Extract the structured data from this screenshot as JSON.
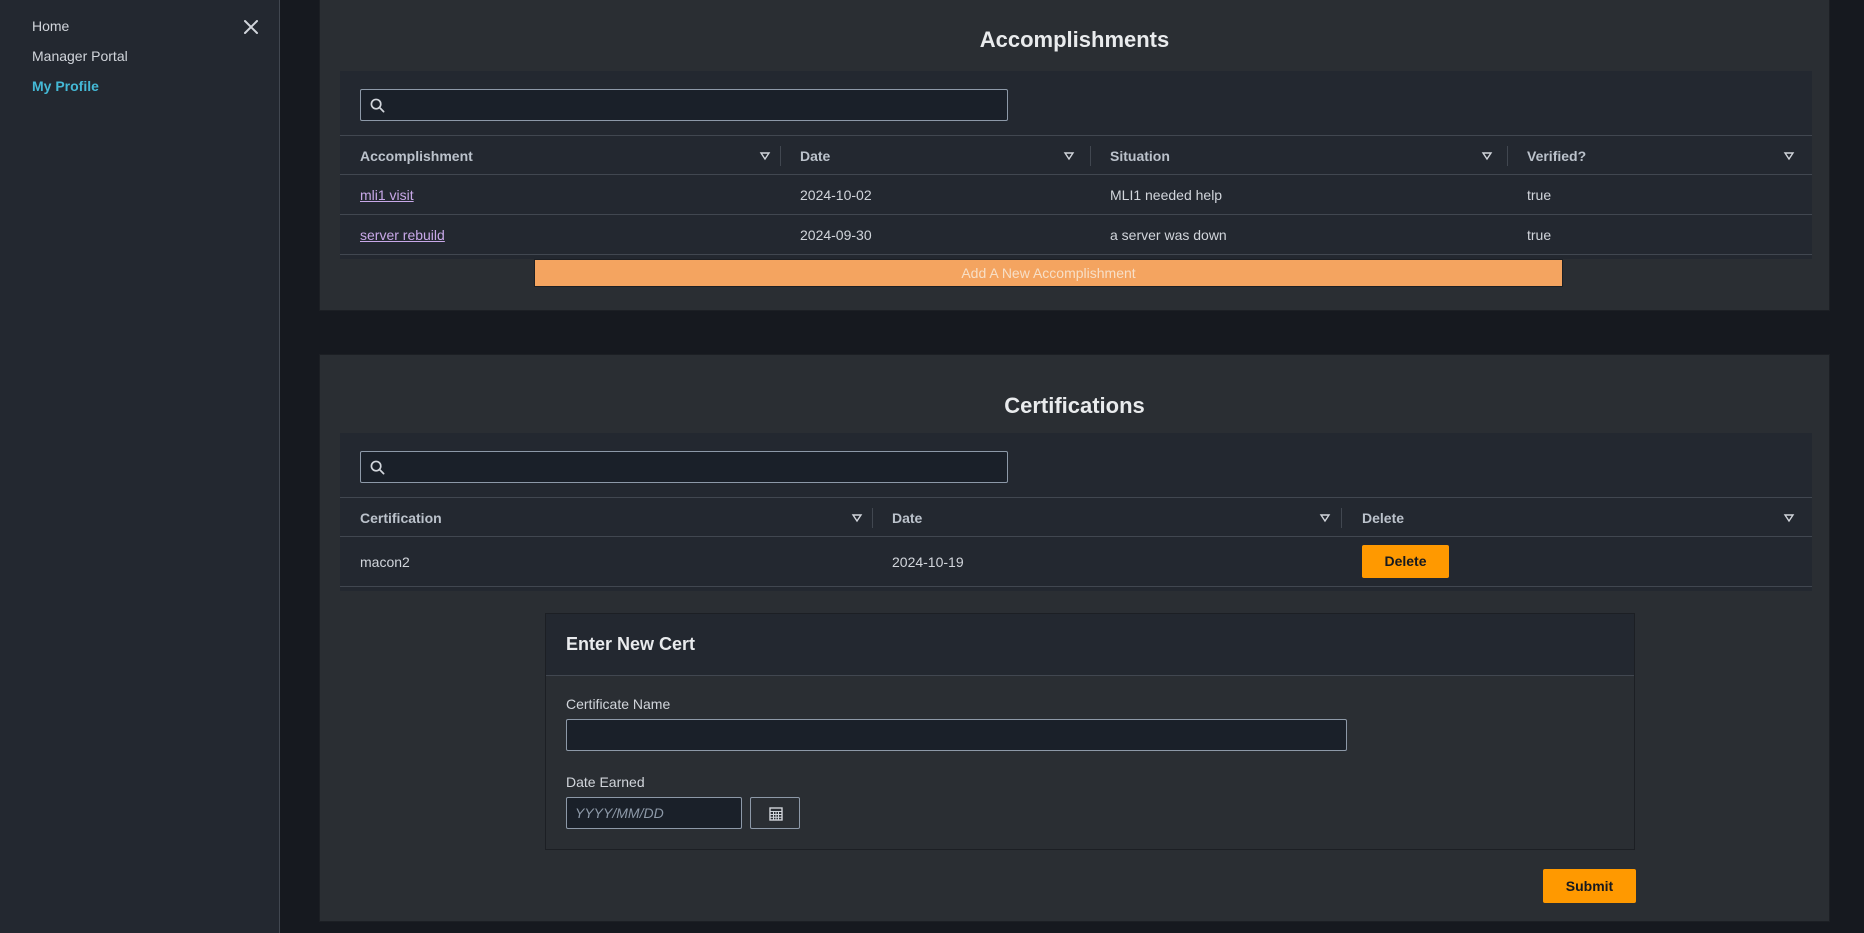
{
  "sidebar": {
    "items": [
      {
        "label": "Home"
      },
      {
        "label": "Manager Portal"
      },
      {
        "label": "My Profile"
      }
    ]
  },
  "accomplishments": {
    "title": "Accomplishments",
    "search_value": "",
    "columns": [
      "Accomplishment",
      "Date",
      "Situation",
      "Verified?"
    ],
    "rows": [
      {
        "name": "mli1 visit",
        "date": "2024-10-02",
        "situation": "MLI1 needed help",
        "verified": "true"
      },
      {
        "name": "server rebuild",
        "date": "2024-09-30",
        "situation": "a server was down",
        "verified": "true"
      }
    ],
    "add_label": "Add A New Accomplishment"
  },
  "certifications": {
    "title": "Certifications",
    "search_value": "",
    "columns": [
      "Certification",
      "Date",
      "Delete"
    ],
    "rows": [
      {
        "name": "macon2",
        "date": "2024-10-19",
        "delete_label": "Delete"
      }
    ],
    "form": {
      "title": "Enter New Cert",
      "name_label": "Certificate Name",
      "name_value": "",
      "date_label": "Date Earned",
      "date_placeholder": "YYYY/MM/DD",
      "submit_label": "Submit"
    }
  },
  "colors": {
    "accent": "#ff9900",
    "add_button": "#f4a460",
    "active_nav": "#44b9d6",
    "link": "#c8a8e8"
  }
}
